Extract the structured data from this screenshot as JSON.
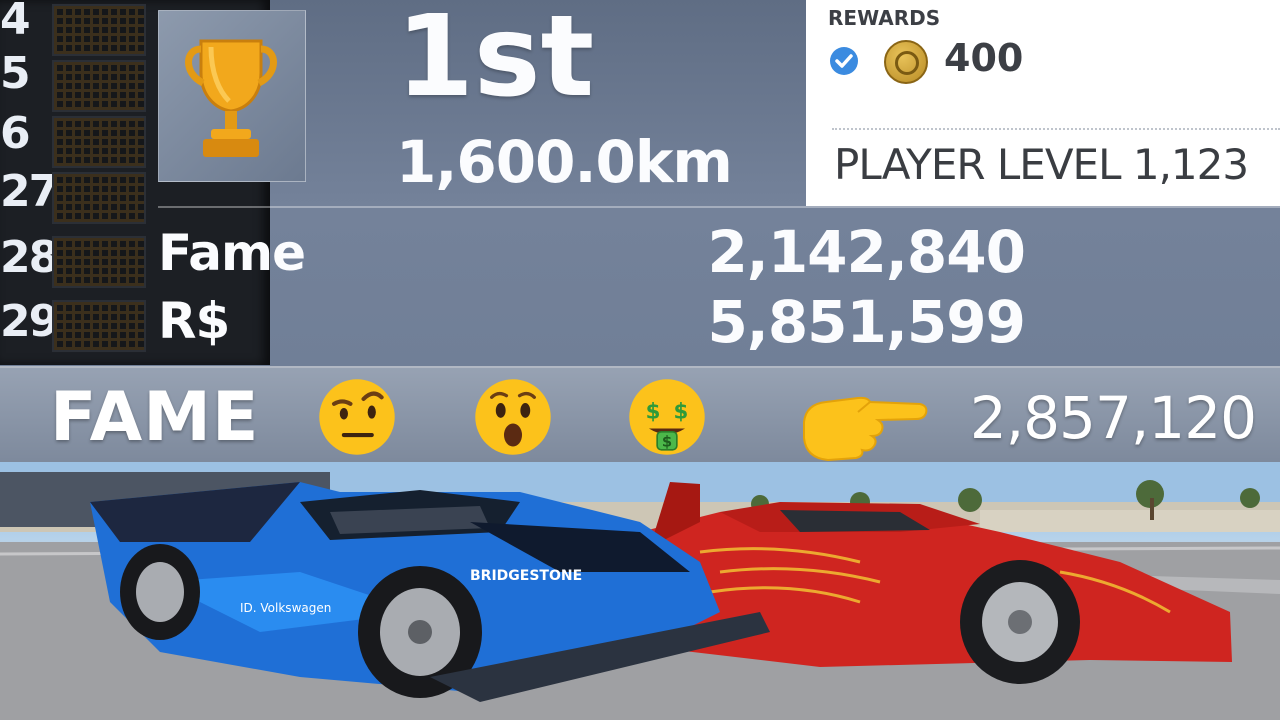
{
  "pit_board": {
    "numbers": [
      "4",
      "5",
      "6",
      "27",
      "28",
      "29"
    ]
  },
  "result": {
    "place": "1st",
    "distance": "1,600.0km"
  },
  "stats": [
    {
      "label": "Fame",
      "value": "2,142,840"
    },
    {
      "label": "R$",
      "value": "5,851,599"
    }
  ],
  "rewards": {
    "title": "REWARDS",
    "amount": "400",
    "player_level": "PLAYER LEVEL 1,123"
  },
  "banner": {
    "label": "FAME",
    "value": "2,857,120",
    "emojis": [
      "raised-eyebrow-face-icon",
      "astonished-face-icon",
      "money-mouth-face-icon",
      "pointing-right-hand-icon"
    ]
  },
  "colors": {
    "panel": "#6e7d95",
    "rewards_bg": "#ffffff",
    "blue_car": "#1f6fd6",
    "red_car": "#d3261f"
  }
}
